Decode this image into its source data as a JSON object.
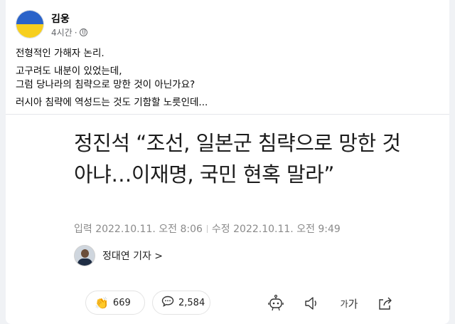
{
  "post": {
    "author": "김웅",
    "time": "4시간",
    "paragraphs": [
      "전형적인 가해자 논리.",
      "고구려도 내분이 있었는데,",
      "그럼 당나라의 침략으로 망한 것이 아닌가요?",
      "러시아 침략에 역성드는 것도 기함할 노릇인데..."
    ],
    "avatar_colors": {
      "top": "#2a63c9",
      "bottom": "#f7cf1e"
    }
  },
  "article": {
    "headline": "정진석 “조선, 일본군 침략으로 망한 것 아냐…이재명, 국민 현혹 말라”",
    "input_date": "입력 2022.10.11. 오전 8:06",
    "modified_date": "수정 2022.10.11. 오전 9:49",
    "reporter": "정대연 기자 >",
    "reactions": {
      "likes": "669",
      "comments": "2,584"
    },
    "text_size_label_small": "가",
    "text_size_label_big": "가",
    "icons": [
      "clap-icon",
      "comment-icon",
      "robot-icon",
      "speaker-icon",
      "text-size-icon",
      "share-icon"
    ]
  }
}
